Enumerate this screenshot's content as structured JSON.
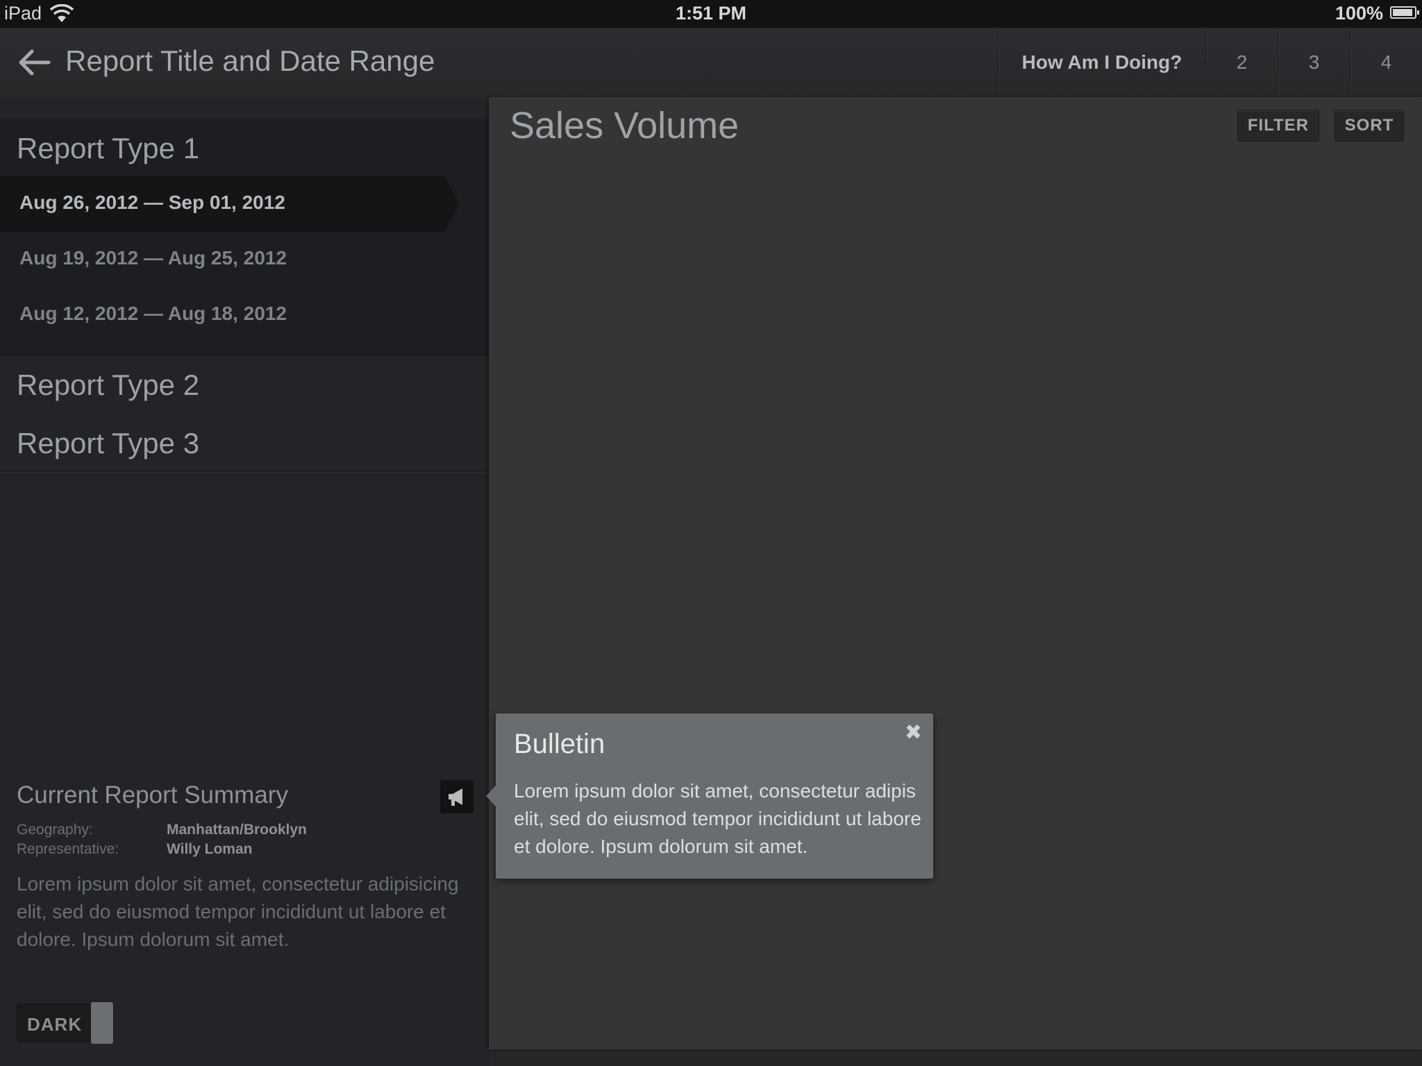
{
  "status_bar": {
    "carrier": "iPad",
    "time": "1:51 PM",
    "battery": "100%"
  },
  "nav": {
    "back_icon": "back-arrow-icon",
    "title": "Report Title and Date Range",
    "tabs": [
      {
        "label": "How Am I Doing?"
      },
      {
        "label": "2"
      },
      {
        "label": "3"
      },
      {
        "label": "4"
      }
    ]
  },
  "sidebar": {
    "sections": [
      {
        "title": "Report Type 1"
      },
      {
        "title": "Report Type 2"
      },
      {
        "title": "Report Type 3"
      }
    ],
    "dates": [
      {
        "label": "Aug 26, 2012 — Sep 01, 2012",
        "selected": true
      },
      {
        "label": "Aug 19, 2012 — Aug 25, 2012",
        "selected": false
      },
      {
        "label": "Aug 12, 2012 — Aug 18, 2012",
        "selected": false
      }
    ],
    "summary": {
      "title": "Current Report Summary",
      "geography_label": "Geography:",
      "geography_value": "Manhattan/Brooklyn",
      "representative_label": "Representative:",
      "representative_value": "Willy Loman",
      "text": "Lorem ipsum dolor sit amet, consectetur adipisicing elit, sed do eiusmod tempor incididunt ut labore et dolore. Ipsum dolorum sit amet.",
      "megaphone_icon": "megaphone-icon"
    },
    "theme_toggle": {
      "label": "DARK"
    }
  },
  "content": {
    "title": "Sales Volume",
    "filter_label": "FILTER",
    "sort_label": "SORT"
  },
  "bulletin": {
    "title": "Bulletin",
    "close_glyph": "✖",
    "text": "Lorem ipsum dolor sit amet, consectetur adipis elit, sed do eiusmod tempor incididunt ut labore et dolore. Ipsum dolorum sit amet."
  }
}
